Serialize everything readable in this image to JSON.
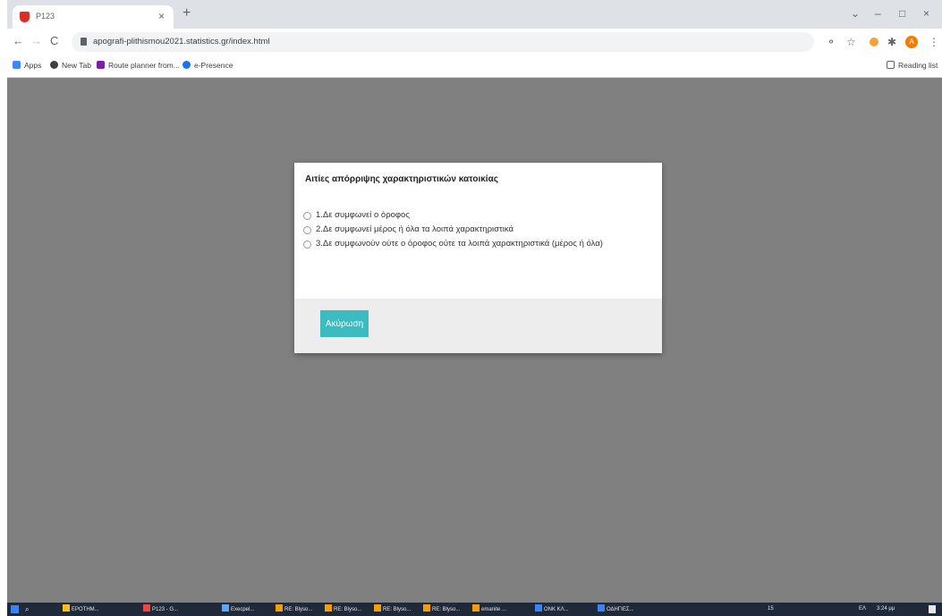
{
  "browser": {
    "tab_title": "P123",
    "tab_close": "×",
    "new_tab": "+",
    "window_controls": [
      "⌄",
      "–",
      "□",
      "×"
    ],
    "nav": {
      "back": "←",
      "forward": "→",
      "reload": "C"
    },
    "url": "apografi-plithismou2021.statistics.gr/index.html",
    "toolbar_icons": [
      "⚬",
      "☆",
      "✱"
    ],
    "profile_letter": "A",
    "menu": "⋮"
  },
  "bookmarks": {
    "items": [
      "Apps",
      "New Tab",
      "Route planner from...",
      "e-Presence"
    ],
    "reading_list": "Reading list"
  },
  "modal": {
    "title": "Αιτίες απόρριψης χαρακτηριστικών κατοικίας",
    "options": [
      "1.Δε συμφωνεί ο όροφος",
      "2.Δε συμφωνεί μέρος ή όλα τα λοιπά χαρακτηριστικά",
      "3.Δε συμφωνούν ούτε ο όροφος ούτε τα λοιπά χαρακτηριστικά (μέρος ή όλα)"
    ],
    "cancel_label": "Ακύρωση"
  },
  "taskbar": {
    "items": [
      "ΕΡΟΤΗΜ...",
      "P123 - G...",
      "Execpel...",
      "RE: Blyso...",
      "RE: Blyso...",
      "RE: Blyso...",
      "RE: Blyso...",
      "emanite ...",
      "ΟΝΚ ΚΛ...",
      "ΟΔΗΓΙΕΣ..."
    ],
    "tray": [
      "15",
      "ΕΛ",
      "3:24 μμ"
    ]
  }
}
